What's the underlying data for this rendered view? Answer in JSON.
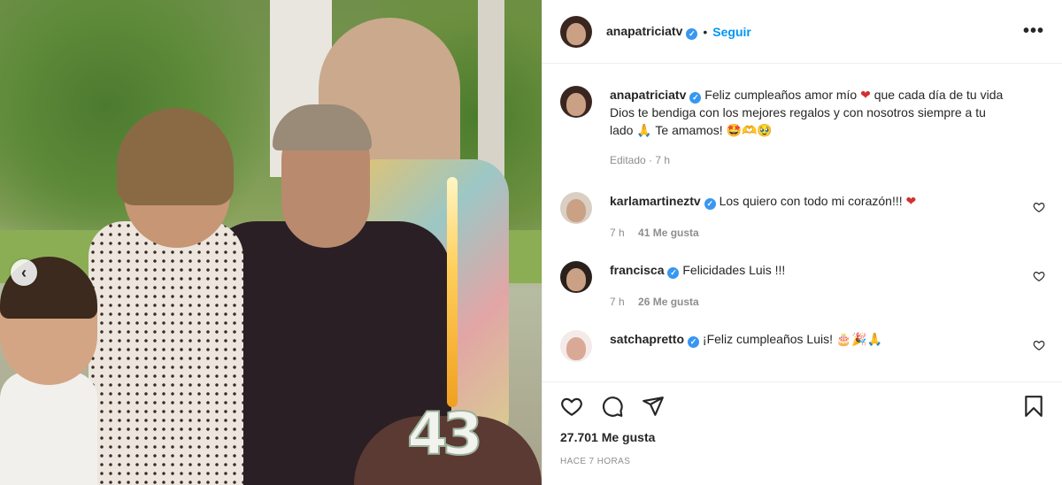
{
  "post": {
    "photo": {
      "candle_number": "43"
    },
    "prev_label": "‹"
  },
  "header": {
    "username": "anapatriciatv",
    "verified_mark": "✓",
    "separator": "•",
    "follow_label": "Seguir",
    "more_label": "•••"
  },
  "caption": {
    "username": "anapatriciatv",
    "verified_mark": "✓",
    "text_before_heart": "Feliz cumpleaños amor mío",
    "heart": "❤",
    "text_after_heart": "que cada día de tu vida Dios te bendiga con los mejores regalos y con nosotros siempre a tu lado 🙏 Te amamos! 🤩🫶🥹",
    "time": "Editado · 7 h"
  },
  "comments": [
    {
      "username": "karlamartineztv",
      "verified_mark": "✓",
      "text": "Los quiero con todo mi corazón!!!",
      "emoji": "❤",
      "time": "7 h",
      "likes": "41 Me gusta"
    },
    {
      "username": "francisca",
      "verified_mark": "✓",
      "text": "Felicidades Luis !!!",
      "emoji": "",
      "time": "7 h",
      "likes": "26 Me gusta"
    },
    {
      "username": "satchapretto",
      "verified_mark": "✓",
      "text": "¡Feliz cumpleaños Luis!",
      "emoji": "🎂🎉🙏",
      "time": "",
      "likes": ""
    }
  ],
  "actions": {
    "like_count": "27.701 Me gusta",
    "timestamp": "HACE 7 HORAS"
  },
  "icons": {
    "like": "heart-outline-icon",
    "comment": "comment-bubble-icon",
    "share": "paper-plane-icon",
    "save": "bookmark-icon",
    "more": "more-horizontal-icon",
    "prev": "chevron-left-icon"
  },
  "colors": {
    "link_blue": "#0095f6",
    "verified_blue": "#3897f0",
    "muted_gray": "#8e8e8e",
    "heart_red": "#d32f2f"
  }
}
